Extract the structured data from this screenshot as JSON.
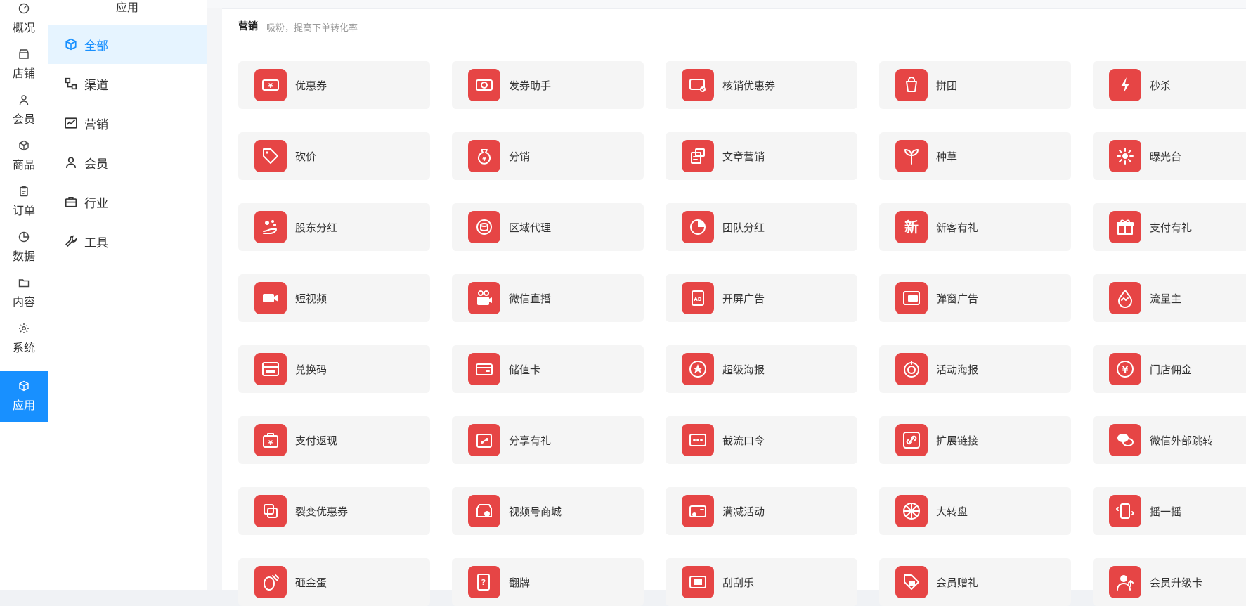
{
  "colors": {
    "accent": "#1890ff",
    "icon_bg": "#e64545",
    "card_bg": "#f5f5f5",
    "active_menu_bg": "#e6f4ff"
  },
  "rail": [
    {
      "label": "概况",
      "icon": "gauge-icon"
    },
    {
      "label": "店铺",
      "icon": "store-icon"
    },
    {
      "label": "会员",
      "icon": "user-icon"
    },
    {
      "label": "商品",
      "icon": "box-icon"
    },
    {
      "label": "订单",
      "icon": "clipboard-icon"
    },
    {
      "label": "数据",
      "icon": "pie-chart-icon"
    },
    {
      "label": "内容",
      "icon": "folder-icon"
    },
    {
      "label": "系统",
      "icon": "gear-icon"
    },
    {
      "label": "应用",
      "icon": "cube-icon",
      "active": true
    }
  ],
  "menu": {
    "title": "应用",
    "items": [
      {
        "label": "全部",
        "icon": "cube-icon",
        "active": true
      },
      {
        "label": "渠道",
        "icon": "channel-icon"
      },
      {
        "label": "营销",
        "icon": "trend-icon"
      },
      {
        "label": "会员",
        "icon": "user-icon"
      },
      {
        "label": "行业",
        "icon": "briefcase-icon"
      },
      {
        "label": "工具",
        "icon": "wrench-icon"
      }
    ]
  },
  "section": {
    "title": "营销",
    "subtitle": "吸粉，提高下单转化率"
  },
  "apps": [
    [
      "优惠券",
      "发券助手",
      "核销优惠券",
      "拼团",
      "秒杀"
    ],
    [
      "砍价",
      "分销",
      "文章营销",
      "种草",
      "曝光台"
    ],
    [
      "股东分红",
      "区域代理",
      "团队分红",
      "新客有礼",
      "支付有礼"
    ],
    [
      "短视频",
      "微信直播",
      "开屏广告",
      "弹窗广告",
      "流量主"
    ],
    [
      "兑换码",
      "储值卡",
      "超级海报",
      "活动海报",
      "门店佣金"
    ],
    [
      "支付返现",
      "分享有礼",
      "截流口令",
      "扩展链接",
      "微信外部跳转"
    ],
    [
      "裂变优惠券",
      "视频号商城",
      "满减活动",
      "大转盘",
      "摇一摇"
    ],
    [
      "砸金蛋",
      "翻牌",
      "刮刮乐",
      "会员赠礼",
      "会员升级卡"
    ]
  ],
  "app_icons": [
    [
      "coupon-icon",
      "coupon-send-icon",
      "coupon-verify-icon",
      "group-buy-icon",
      "lightning-icon"
    ],
    [
      "price-tag-icon",
      "money-bag-icon",
      "article-icon",
      "sprout-icon",
      "sun-icon"
    ],
    [
      "share-dividend-icon",
      "region-coins-icon",
      "pie-chart-icon",
      "new-badge-icon",
      "gift-icon"
    ],
    [
      "video-camera-icon",
      "live-stream-icon",
      "ad-screen-icon",
      "popup-ad-icon",
      "water-drop-icon"
    ],
    [
      "redeem-code-icon",
      "stored-card-icon",
      "star-poster-icon",
      "activity-poster-icon",
      "store-commission-icon"
    ],
    [
      "cashback-bag-icon",
      "share-gift-icon",
      "command-icon",
      "link-icon",
      "wechat-icon"
    ],
    [
      "fission-coupon-icon",
      "video-shop-icon",
      "discount-wallet-icon",
      "wheel-icon",
      "shake-icon"
    ],
    [
      "golden-egg-icon",
      "flip-card-icon",
      "scratch-card-icon",
      "member-gift-icon",
      "member-upgrade-icon"
    ]
  ],
  "new_badge_text": "新"
}
